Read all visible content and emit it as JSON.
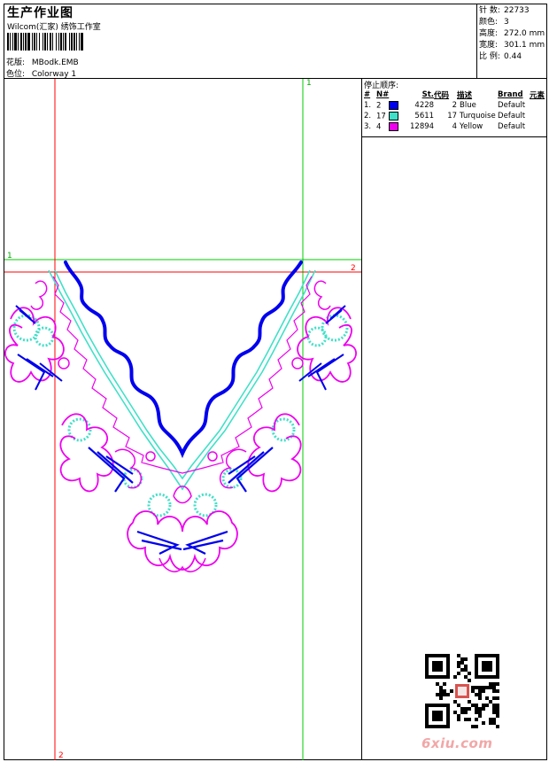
{
  "header": {
    "title": "生产作业图",
    "company": "Wilcom(汇家) 绣饰工作室",
    "design_label": "花版:",
    "design_value": "MBodk.EMB",
    "color_label": "色位:",
    "color_value": "Colorway 1"
  },
  "stats": [
    {
      "label": "针 数:",
      "value": "22733"
    },
    {
      "label": "颜色:",
      "value": "3"
    },
    {
      "label": "高度:",
      "value": "272.0 mm"
    },
    {
      "label": "宽度:",
      "value": "301.1 mm"
    },
    {
      "label": "比 例:",
      "value": "0.44"
    }
  ],
  "stop_sequence": {
    "caption": "停止顺序:",
    "columns": [
      "#",
      "N#",
      "St.",
      "代码",
      "描述",
      "Brand",
      "元素"
    ],
    "rows": [
      {
        "idx": "1.",
        "n": "2",
        "color": "#0000ee",
        "st": "4228",
        "code": "2",
        "desc": "Blue",
        "brand": "Default"
      },
      {
        "idx": "2.",
        "n": "17",
        "color": "#40e0c8",
        "st": "5611",
        "code": "17",
        "desc": "Turquoise",
        "brand": "Default"
      },
      {
        "idx": "3.",
        "n": "4",
        "color": "#ee00ee",
        "st": "12894",
        "code": "4",
        "desc": "Yellow",
        "brand": "Default"
      }
    ]
  },
  "guides": {
    "green_v": "1",
    "green_h": "1",
    "red_h": "2",
    "red_v": "2"
  },
  "watermark": "6xiu.com",
  "colors": {
    "blue": "#0000ee",
    "turquoise": "#40e0c8",
    "magenta": "#ee00ee",
    "guide_red": "#ff0000",
    "guide_green": "#00cc00"
  }
}
